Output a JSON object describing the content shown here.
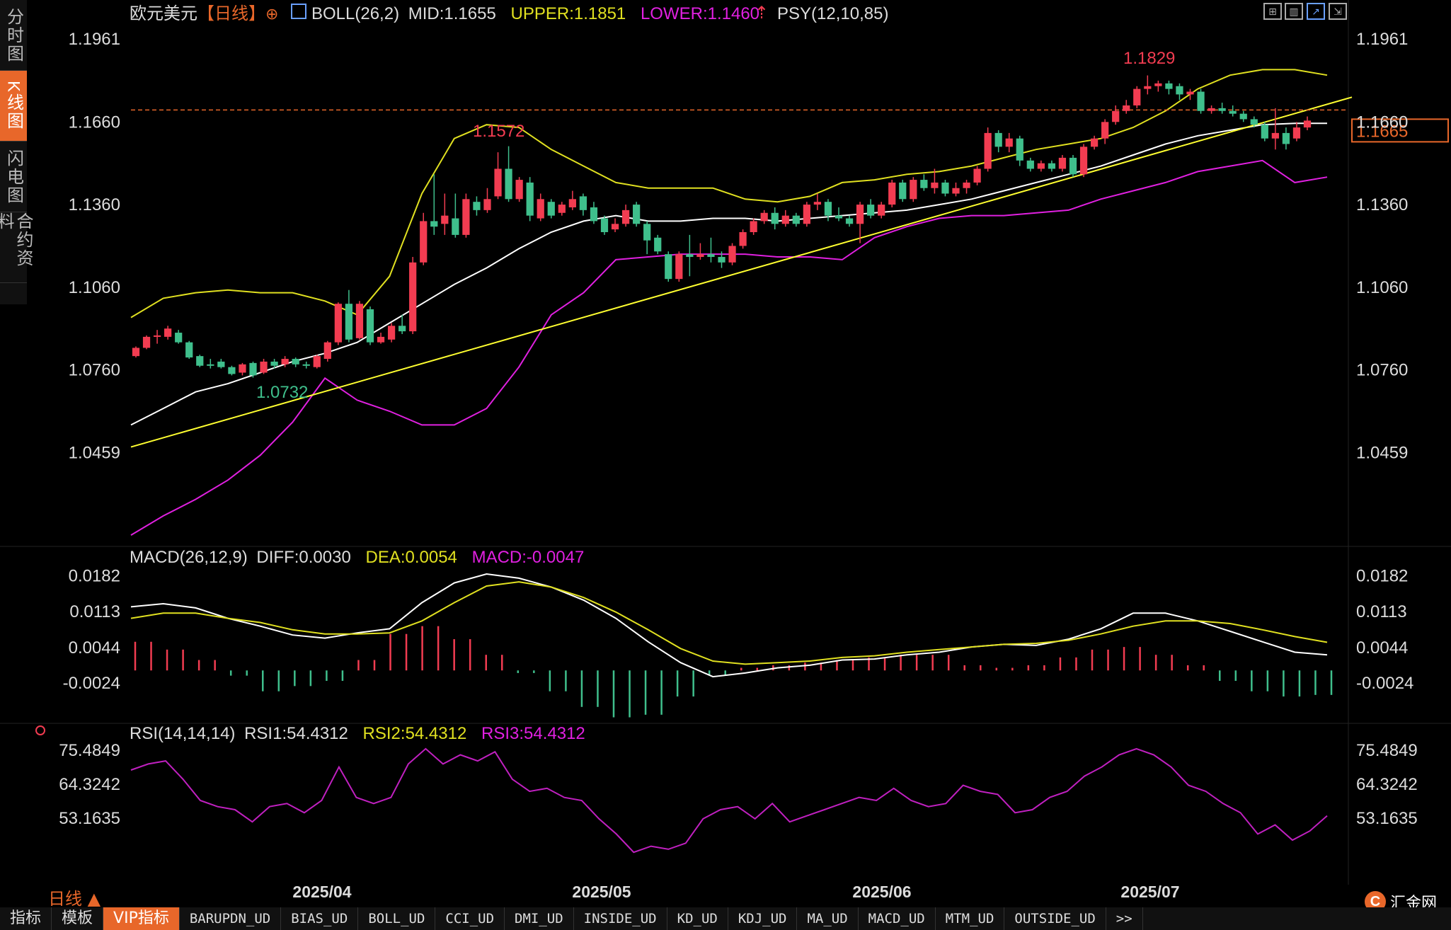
{
  "sidebar": {
    "tabs": [
      {
        "label": "分时图",
        "active": false
      },
      {
        "label": "K线图",
        "active": true
      },
      {
        "label": "闪电图",
        "active": false
      },
      {
        "label": "合约资料",
        "active": false
      }
    ]
  },
  "header": {
    "symbol": "欧元美元",
    "period_tag": "【日线】",
    "boll_label": "BOLL(26,2)",
    "boll_mid": "MID:1.1655",
    "boll_upper": "UPPER:1.1851",
    "boll_lower": "LOWER:1.1460",
    "psy_label": "PSY(12,10,85)"
  },
  "macd_header": {
    "label": "MACD(26,12,9)",
    "diff": "DIFF:0.0030",
    "dea": "DEA:0.0054",
    "macd": "MACD:-0.0047"
  },
  "rsi_header": {
    "label": "RSI(14,14,14)",
    "rsi1": "RSI1:54.4312",
    "rsi2": "RSI2:54.4312",
    "rsi3": "RSI3:54.4312"
  },
  "period_label": "日线 ▲",
  "bottom_tabs": [
    "指标",
    "模板",
    "VIP指标",
    "BARUPDN_UD",
    "BIAS_UD",
    "BOLL_UD",
    "CCI_UD",
    "DMI_UD",
    "INSIDE_UD",
    "KD_UD",
    "KDJ_UD",
    "MA_UD",
    "MACD_UD",
    "MTM_UD",
    "OUTSIDE_UD",
    ">>"
  ],
  "logo_text": "汇金网",
  "colors": {
    "up": "#f23c51",
    "down": "#3fbf8c",
    "boll_mid": "#ffffff",
    "boll_upper": "#e0e020",
    "boll_lower": "#e020e0",
    "trendline": "#ffff30",
    "accent": "#e8672a",
    "dea": "#e0e020",
    "rsi": "#c020c0"
  },
  "chart_data": [
    {
      "type": "candlestick",
      "title": "欧元美元【日线】",
      "x_ticks": [
        "2025/04",
        "2025/05",
        "2025/06",
        "2025/07"
      ],
      "y_ticks": [
        "1.1961",
        "1.1660",
        "1.1360",
        "1.1060",
        "1.0760",
        "1.0459"
      ],
      "ylim": [
        1.015,
        1.2
      ],
      "current_price": "1.1665",
      "annotations": {
        "high_1": "1.1572",
        "high_2": "1.1829",
        "low_1": "1.0732"
      },
      "candles": [
        [
          1.081,
          1.084,
          1.0805,
          1.0845
        ],
        [
          1.084,
          1.088,
          1.0835,
          1.0885
        ],
        [
          1.088,
          1.0885,
          1.0855,
          1.0905
        ],
        [
          1.088,
          1.091,
          1.087,
          1.092
        ],
        [
          1.0895,
          1.086,
          1.0855,
          1.0905
        ],
        [
          1.086,
          1.0805,
          1.08,
          1.0865
        ],
        [
          1.081,
          1.0775,
          1.077,
          1.0815
        ],
        [
          1.078,
          1.0775,
          1.0765,
          1.08
        ],
        [
          1.079,
          1.077,
          1.0765,
          1.08
        ],
        [
          1.077,
          1.0745,
          1.074,
          1.0775
        ],
        [
          1.075,
          1.078,
          1.074,
          1.0785
        ],
        [
          1.0785,
          1.074,
          1.0732,
          1.079
        ],
        [
          1.075,
          1.079,
          1.0745,
          1.08
        ],
        [
          1.079,
          1.0775,
          1.0765,
          1.08
        ],
        [
          1.078,
          1.08,
          1.077,
          1.081
        ],
        [
          1.08,
          1.078,
          1.077,
          1.0805
        ],
        [
          1.078,
          1.0775,
          1.0765,
          1.079
        ],
        [
          1.077,
          1.081,
          1.0765,
          1.0815
        ],
        [
          1.08,
          1.086,
          1.079,
          1.0865
        ],
        [
          1.086,
          1.1,
          1.085,
          1.1005
        ],
        [
          1.1,
          1.087,
          1.086,
          1.105
        ],
        [
          1.0875,
          1.1,
          1.087,
          1.101
        ],
        [
          1.098,
          1.086,
          1.085,
          1.099
        ],
        [
          1.086,
          1.088,
          1.0855,
          1.0895
        ],
        [
          1.087,
          1.092,
          1.086,
          1.093
        ],
        [
          1.092,
          1.09,
          1.089,
          1.096
        ],
        [
          1.09,
          1.115,
          1.089,
          1.117
        ],
        [
          1.115,
          1.13,
          1.114,
          1.133
        ],
        [
          1.13,
          1.128,
          1.125,
          1.147
        ],
        [
          1.129,
          1.132,
          1.125,
          1.14
        ],
        [
          1.131,
          1.125,
          1.124,
          1.14
        ],
        [
          1.125,
          1.138,
          1.124,
          1.14
        ],
        [
          1.137,
          1.134,
          1.132,
          1.139
        ],
        [
          1.134,
          1.138,
          1.133,
          1.142
        ],
        [
          1.139,
          1.149,
          1.138,
          1.155
        ],
        [
          1.149,
          1.138,
          1.137,
          1.1572
        ],
        [
          1.138,
          1.145,
          1.137,
          1.146
        ],
        [
          1.144,
          1.132,
          1.13,
          1.146
        ],
        [
          1.131,
          1.138,
          1.13,
          1.14
        ],
        [
          1.137,
          1.132,
          1.131,
          1.138
        ],
        [
          1.133,
          1.136,
          1.132,
          1.137
        ],
        [
          1.135,
          1.138,
          1.134,
          1.141
        ],
        [
          1.139,
          1.134,
          1.132,
          1.14
        ],
        [
          1.135,
          1.13,
          1.129,
          1.137
        ],
        [
          1.131,
          1.126,
          1.125,
          1.132
        ],
        [
          1.127,
          1.129,
          1.126,
          1.131
        ],
        [
          1.129,
          1.134,
          1.128,
          1.136
        ],
        [
          1.136,
          1.129,
          1.128,
          1.137
        ],
        [
          1.129,
          1.123,
          1.118,
          1.13
        ],
        [
          1.124,
          1.119,
          1.118,
          1.125
        ],
        [
          1.118,
          1.109,
          1.108,
          1.119
        ],
        [
          1.109,
          1.118,
          1.108,
          1.119
        ],
        [
          1.118,
          1.117,
          1.11,
          1.125
        ],
        [
          1.117,
          1.118,
          1.116,
          1.122
        ],
        [
          1.118,
          1.117,
          1.115,
          1.124
        ],
        [
          1.117,
          1.115,
          1.113,
          1.119
        ],
        [
          1.115,
          1.121,
          1.114,
          1.122
        ],
        [
          1.121,
          1.126,
          1.12,
          1.127
        ],
        [
          1.126,
          1.13,
          1.125,
          1.131
        ],
        [
          1.13,
          1.133,
          1.129,
          1.134
        ],
        [
          1.133,
          1.129,
          1.127,
          1.135
        ],
        [
          1.129,
          1.132,
          1.128,
          1.134
        ],
        [
          1.132,
          1.129,
          1.128,
          1.133
        ],
        [
          1.129,
          1.136,
          1.128,
          1.137
        ],
        [
          1.136,
          1.137,
          1.134,
          1.14
        ],
        [
          1.137,
          1.132,
          1.13,
          1.138
        ],
        [
          1.132,
          1.131,
          1.13,
          1.135
        ],
        [
          1.131,
          1.129,
          1.128,
          1.132
        ],
        [
          1.129,
          1.136,
          1.122,
          1.137
        ],
        [
          1.136,
          1.132,
          1.131,
          1.138
        ],
        [
          1.132,
          1.136,
          1.131,
          1.137
        ],
        [
          1.136,
          1.144,
          1.135,
          1.145
        ],
        [
          1.144,
          1.138,
          1.137,
          1.145
        ],
        [
          1.138,
          1.145,
          1.137,
          1.146
        ],
        [
          1.145,
          1.142,
          1.141,
          1.147
        ],
        [
          1.142,
          1.144,
          1.14,
          1.149
        ],
        [
          1.144,
          1.14,
          1.139,
          1.145
        ],
        [
          1.14,
          1.142,
          1.139,
          1.144
        ],
        [
          1.142,
          1.144,
          1.14,
          1.145
        ],
        [
          1.144,
          1.149,
          1.143,
          1.15
        ],
        [
          1.149,
          1.162,
          1.148,
          1.164
        ],
        [
          1.162,
          1.157,
          1.155,
          1.163
        ],
        [
          1.157,
          1.16,
          1.155,
          1.162
        ],
        [
          1.16,
          1.152,
          1.15,
          1.161
        ],
        [
          1.152,
          1.149,
          1.148,
          1.153
        ],
        [
          1.149,
          1.151,
          1.148,
          1.152
        ],
        [
          1.151,
          1.149,
          1.148,
          1.152
        ],
        [
          1.149,
          1.153,
          1.148,
          1.154
        ],
        [
          1.153,
          1.147,
          1.146,
          1.154
        ],
        [
          1.147,
          1.157,
          1.146,
          1.158
        ],
        [
          1.157,
          1.16,
          1.156,
          1.161
        ],
        [
          1.16,
          1.166,
          1.158,
          1.167
        ],
        [
          1.166,
          1.17,
          1.165,
          1.172
        ],
        [
          1.17,
          1.172,
          1.169,
          1.174
        ],
        [
          1.172,
          1.178,
          1.171,
          1.179
        ],
        [
          1.178,
          1.179,
          1.176,
          1.1829
        ],
        [
          1.179,
          1.18,
          1.177,
          1.181
        ],
        [
          1.18,
          1.178,
          1.176,
          1.181
        ],
        [
          1.179,
          1.176,
          1.174,
          1.18
        ],
        [
          1.176,
          1.177,
          1.174,
          1.178
        ],
        [
          1.177,
          1.17,
          1.169,
          1.178
        ],
        [
          1.17,
          1.171,
          1.169,
          1.172
        ],
        [
          1.171,
          1.17,
          1.169,
          1.173
        ],
        [
          1.17,
          1.169,
          1.168,
          1.172
        ],
        [
          1.169,
          1.167,
          1.166,
          1.17
        ],
        [
          1.167,
          1.165,
          1.164,
          1.168
        ],
        [
          1.165,
          1.16,
          1.159,
          1.166
        ],
        [
          1.16,
          1.162,
          1.156,
          1.171
        ],
        [
          1.162,
          1.158,
          1.156,
          1.164
        ],
        [
          1.16,
          1.164,
          1.159,
          1.166
        ],
        [
          1.164,
          1.1665,
          1.163,
          1.168
        ]
      ],
      "boll_upper": [
        1.095,
        1.102,
        1.104,
        1.105,
        1.104,
        1.104,
        1.101,
        1.096,
        1.11,
        1.14,
        1.16,
        1.165,
        1.164,
        1.156,
        1.15,
        1.144,
        1.142,
        1.142,
        1.142,
        1.138,
        1.137,
        1.139,
        1.144,
        1.145,
        1.147,
        1.148,
        1.15,
        1.153,
        1.156,
        1.158,
        1.16,
        1.164,
        1.17,
        1.178,
        1.183,
        1.185,
        1.185,
        1.183
      ],
      "boll_mid": [
        1.056,
        1.062,
        1.068,
        1.071,
        1.075,
        1.079,
        1.082,
        1.086,
        1.093,
        1.1,
        1.107,
        1.113,
        1.12,
        1.126,
        1.13,
        1.132,
        1.13,
        1.13,
        1.131,
        1.131,
        1.13,
        1.131,
        1.132,
        1.133,
        1.134,
        1.136,
        1.138,
        1.141,
        1.144,
        1.147,
        1.15,
        1.154,
        1.158,
        1.161,
        1.163,
        1.165,
        1.1655,
        1.1655
      ],
      "boll_lower": [
        1.016,
        1.023,
        1.029,
        1.036,
        1.045,
        1.057,
        1.073,
        1.065,
        1.061,
        1.056,
        1.056,
        1.062,
        1.077,
        1.096,
        1.104,
        1.116,
        1.117,
        1.118,
        1.118,
        1.118,
        1.117,
        1.117,
        1.116,
        1.124,
        1.128,
        1.131,
        1.132,
        1.132,
        1.133,
        1.134,
        1.138,
        1.141,
        1.144,
        1.148,
        1.15,
        1.152,
        1.144,
        1.146
      ],
      "trendline": {
        "start": 1.048,
        "end": 1.175
      }
    },
    {
      "type": "bar+line",
      "title": "MACD(26,12,9)",
      "y_ticks": [
        "0.0182",
        "0.0113",
        "0.0044",
        "-0.0024"
      ],
      "ylim": [
        -0.0092,
        0.02
      ],
      "diff": [
        0.0122,
        0.0128,
        0.012,
        0.01,
        0.0085,
        0.0068,
        0.0062,
        0.0072,
        0.008,
        0.013,
        0.0168,
        0.0185,
        0.0177,
        0.016,
        0.0135,
        0.01,
        0.0055,
        0.0015,
        -0.0012,
        -0.0005,
        0.0005,
        0.001,
        0.002,
        0.0022,
        0.003,
        0.0035,
        0.0045,
        0.005,
        0.0048,
        0.006,
        0.008,
        0.011,
        0.011,
        0.0095,
        0.0075,
        0.0055,
        0.0035,
        0.003
      ],
      "dea": [
        0.01,
        0.011,
        0.011,
        0.01,
        0.0092,
        0.0078,
        0.007,
        0.007,
        0.0072,
        0.0095,
        0.013,
        0.0162,
        0.017,
        0.016,
        0.014,
        0.0112,
        0.0078,
        0.0042,
        0.0018,
        0.0012,
        0.0015,
        0.0018,
        0.0025,
        0.0028,
        0.0035,
        0.004,
        0.0045,
        0.005,
        0.0052,
        0.0058,
        0.007,
        0.0085,
        0.0095,
        0.0095,
        0.009,
        0.0078,
        0.0065,
        0.0054
      ],
      "macd": [
        0.0055,
        0.004,
        0.002,
        -0.001,
        -0.004,
        -0.003,
        -0.002,
        0.002,
        0.007,
        0.0085,
        0.006,
        0.003,
        -0.0005,
        -0.004,
        -0.007,
        -0.009,
        -0.0085,
        -0.005,
        -0.001,
        0.0005,
        0.001,
        0.0015,
        0.002,
        0.0025,
        0.003,
        0.003,
        0.001,
        0.0005,
        0.001,
        0.0025,
        0.004,
        0.0045,
        0.003,
        0.001,
        -0.002,
        -0.004,
        -0.005,
        -0.0047
      ]
    },
    {
      "type": "line",
      "title": "RSI(14,14,14)",
      "y_ticks": [
        "75.4849",
        "64.3242",
        "53.1635"
      ],
      "ylim": [
        36.0,
        79.0
      ],
      "rsi": [
        69,
        71,
        72,
        66,
        59,
        57,
        56,
        52,
        57,
        58,
        55,
        59,
        70,
        60,
        58,
        60,
        71,
        76,
        71,
        74,
        72,
        75,
        66,
        62,
        63,
        60,
        59,
        53,
        48,
        42,
        44,
        43,
        45,
        53,
        56,
        57,
        53,
        58,
        52,
        54,
        56,
        58,
        60,
        59,
        63,
        59,
        57,
        58,
        64,
        62,
        61,
        55,
        56,
        60,
        62,
        67,
        70,
        74,
        76,
        74,
        70,
        64,
        62,
        58,
        55,
        48,
        51,
        46,
        49,
        54
      ]
    }
  ]
}
